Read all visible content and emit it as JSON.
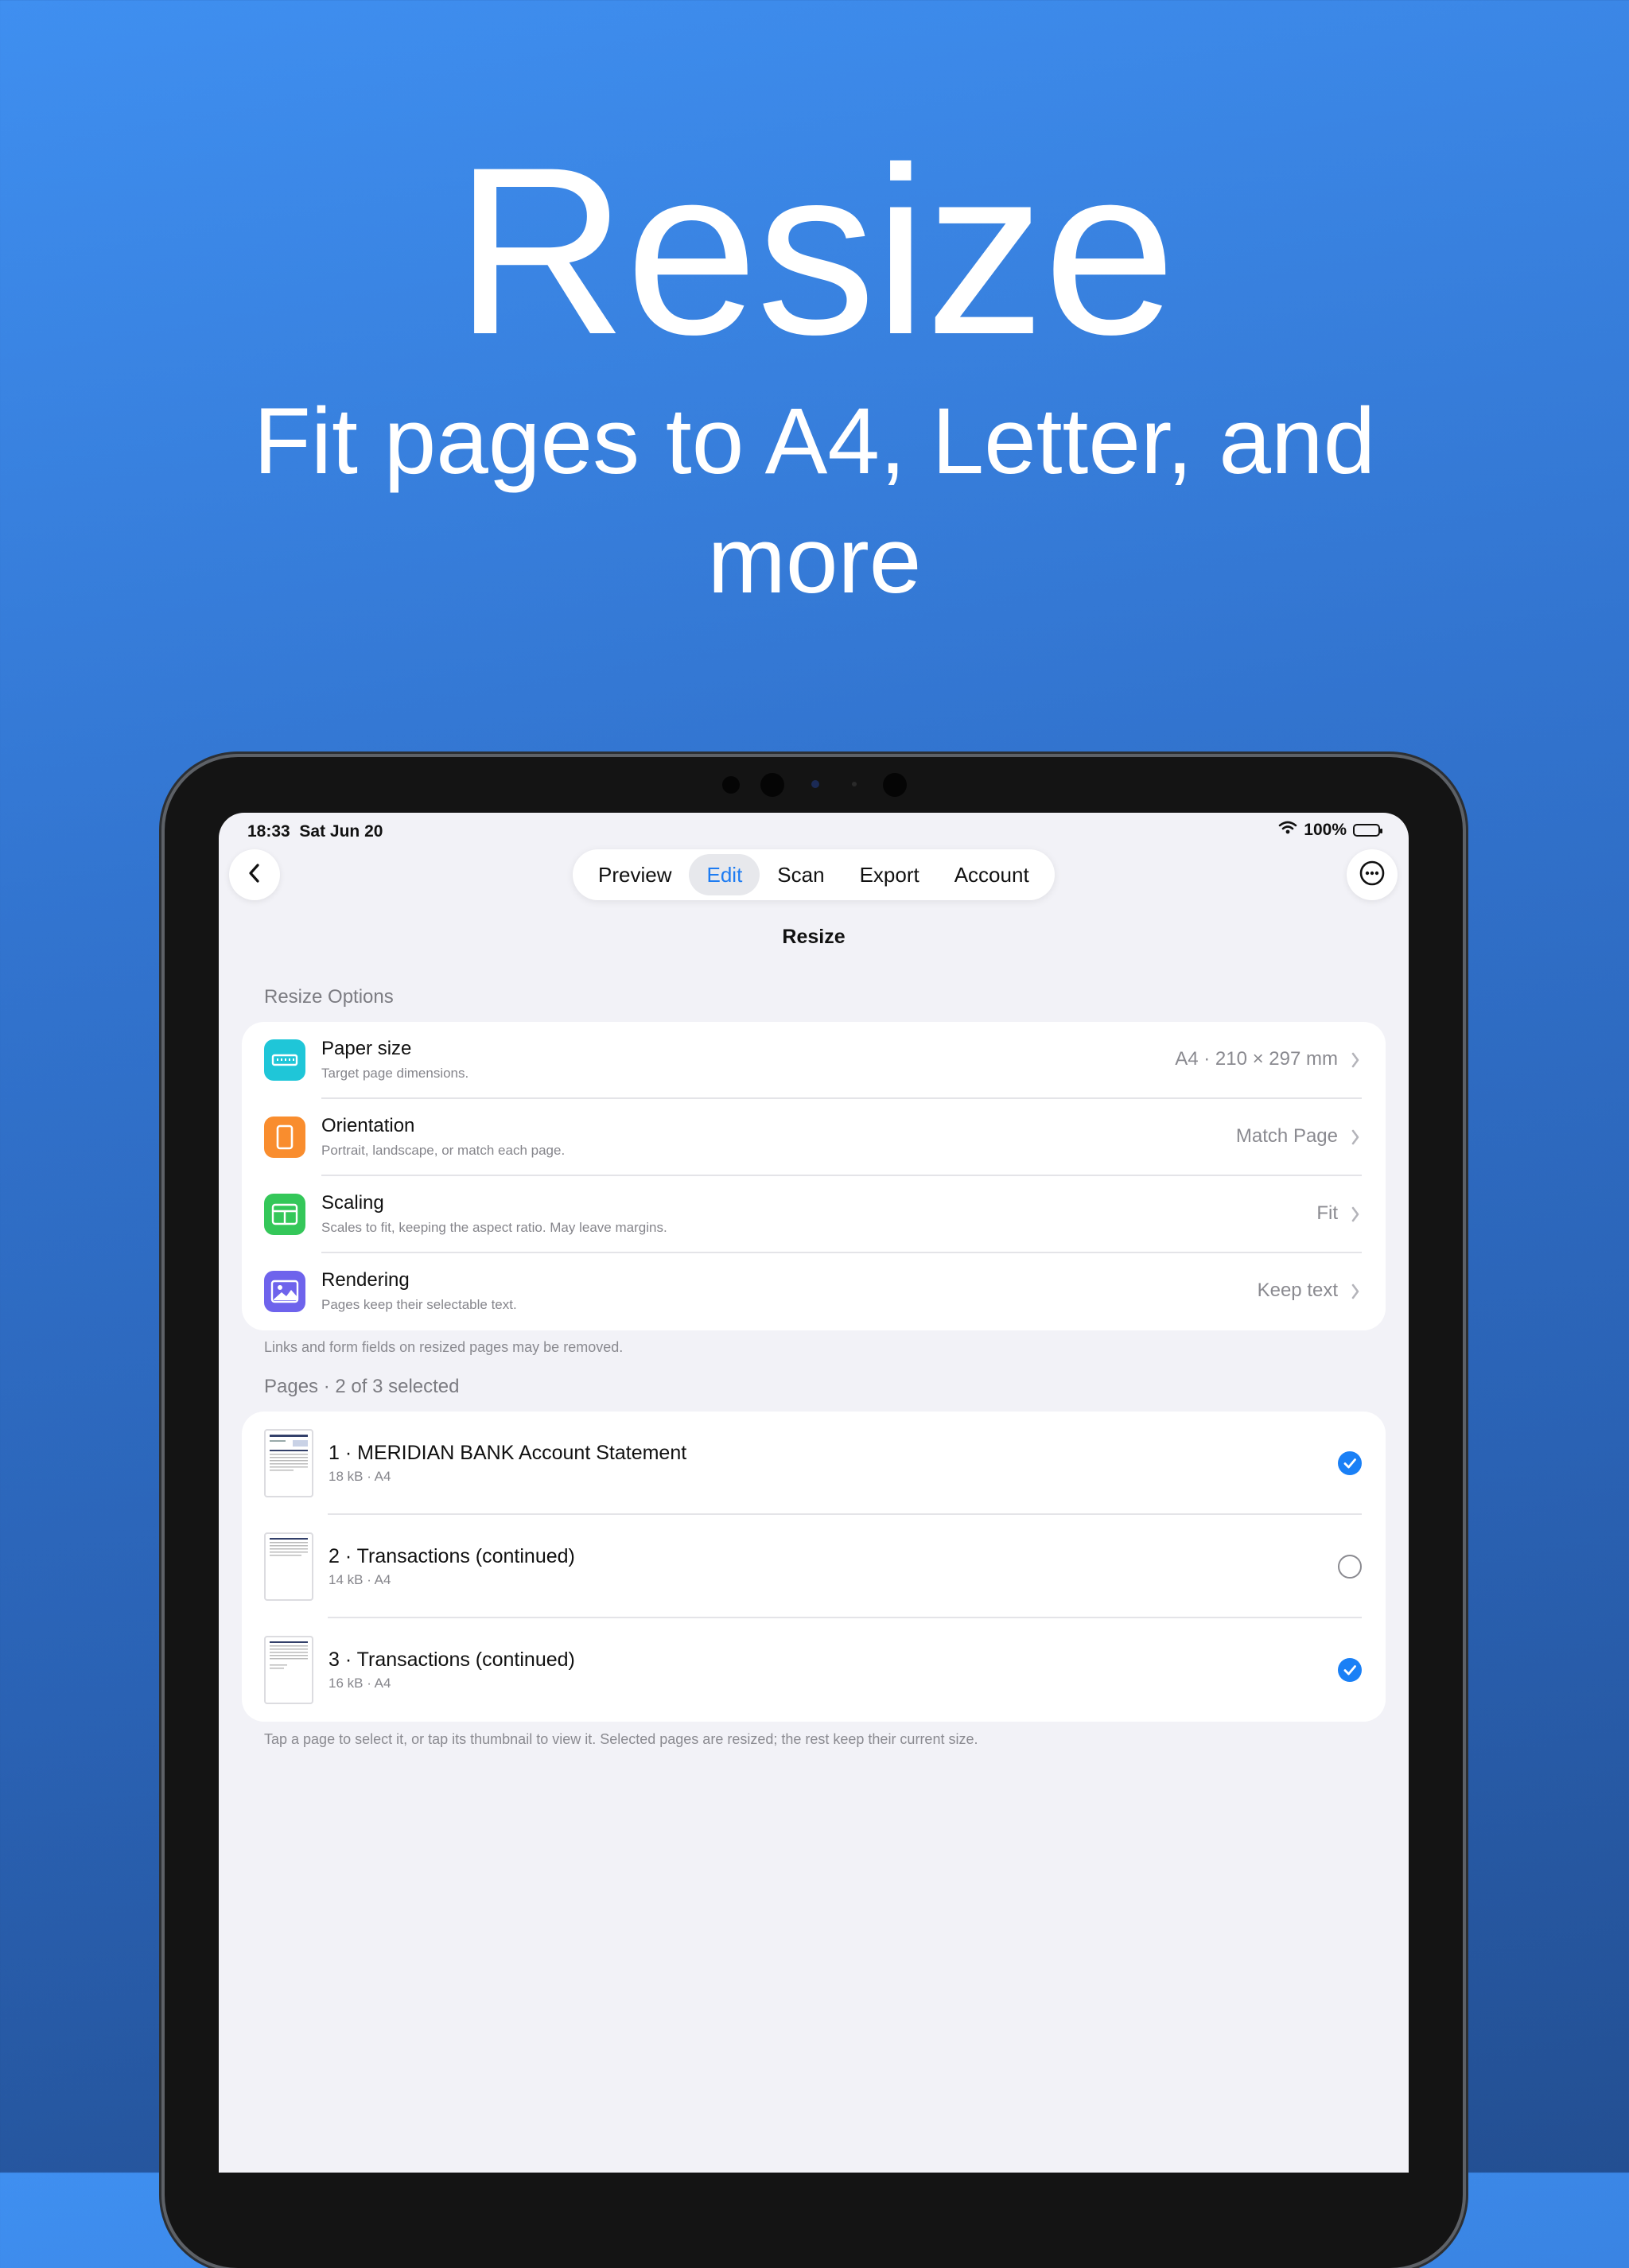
{
  "hero": {
    "title": "Resize",
    "subtitle": "Fit pages to A4, Letter, and more"
  },
  "status_bar": {
    "time": "18:33",
    "date": "Sat Jun 20",
    "battery": "100%"
  },
  "toolbar": {
    "back_icon": "chevron-left-icon",
    "more_icon": "ellipsis-circle-icon",
    "tabs": [
      {
        "label": "Preview",
        "active": false
      },
      {
        "label": "Edit",
        "active": true
      },
      {
        "label": "Scan",
        "active": false
      },
      {
        "label": "Export",
        "active": false
      },
      {
        "label": "Account",
        "active": false
      }
    ]
  },
  "nav_title": "Resize",
  "options_section": {
    "header": "Resize Options",
    "footer": "Links and form fields on resized pages may be removed.",
    "rows": [
      {
        "title": "Paper size",
        "subtitle": "Target page dimensions.",
        "value": "A4 · 210 × 297 mm",
        "icon": "ruler-icon",
        "color": "#1fc6d8"
      },
      {
        "title": "Orientation",
        "subtitle": "Portrait, landscape, or match each page.",
        "value": "Match Page",
        "icon": "portrait-page-icon",
        "color": "#f98d2e"
      },
      {
        "title": "Scaling",
        "subtitle": "Scales to fit, keeping the aspect ratio. May leave margins.",
        "value": "Fit",
        "icon": "layout-icon",
        "color": "#34c759"
      },
      {
        "title": "Rendering",
        "subtitle": "Pages keep their selectable text.",
        "value": "Keep text",
        "icon": "photo-icon",
        "color": "#6e63ec"
      }
    ]
  },
  "pages_section": {
    "header": "Pages · 2 of 3 selected",
    "footer": "Tap a page to select it, or tap its thumbnail to view it. Selected pages are resized; the rest keep their current size.",
    "rows": [
      {
        "title": "1 · MERIDIAN BANK Account Statement",
        "meta": "18 kB · A4",
        "selected": true
      },
      {
        "title": "2 · Transactions (continued)",
        "meta": "14 kB · A4",
        "selected": false
      },
      {
        "title": "3 · Transactions (continued)",
        "meta": "16 kB · A4",
        "selected": true
      }
    ]
  },
  "colors": {
    "accent": "#1a80f6",
    "background_top": "#3f8ff0",
    "background_bottom": "#234f92"
  }
}
